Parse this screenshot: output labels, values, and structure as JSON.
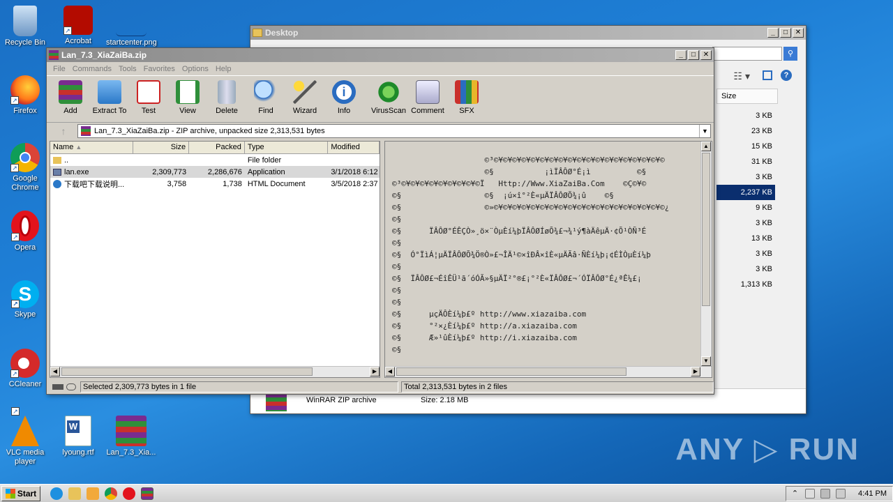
{
  "desktop": {
    "icons": [
      {
        "label": "Recycle Bin"
      },
      {
        "label": "Acrobat"
      },
      {
        "label": "startcenter.png"
      },
      {
        "label": "Firefox"
      },
      {
        "label": "Google Chrome"
      },
      {
        "label": "Opera"
      },
      {
        "label": "Skype"
      },
      {
        "label": "CCleaner"
      },
      {
        "label": "VLC media player"
      },
      {
        "label": "lyoung.rtf"
      },
      {
        "label": "Lan_7.3_Xia..."
      }
    ]
  },
  "explorer": {
    "title": "Desktop",
    "column_size": "Size",
    "sizes": [
      "3 KB",
      "23 KB",
      "15 KB",
      "31 KB",
      "3 KB",
      "2,237 KB",
      "9 KB",
      "3 KB",
      "13 KB",
      "3 KB",
      "3 KB",
      "1,313 KB"
    ],
    "details_type": "WinRAR ZIP archive",
    "details_size": "Size: 2.18 MB"
  },
  "winrar": {
    "title": "Lan_7.3_XiaZaiBa.zip",
    "menu": [
      "File",
      "Commands",
      "Tools",
      "Favorites",
      "Options",
      "Help"
    ],
    "toolbar": [
      "Add",
      "Extract To",
      "Test",
      "View",
      "Delete",
      "Find",
      "Wizard",
      "Info",
      "VirusScan",
      "Comment",
      "SFX"
    ],
    "address": "Lan_7.3_XiaZaiBa.zip - ZIP archive, unpacked size 2,313,531 bytes",
    "columns": [
      "Name",
      "Size",
      "Packed",
      "Type",
      "Modified"
    ],
    "files": [
      {
        "name": "..",
        "size": "",
        "packed": "",
        "type": "File folder",
        "modified": ""
      },
      {
        "name": "lan.exe",
        "size": "2,309,773",
        "packed": "2,286,676",
        "type": "Application",
        "modified": "3/1/2018 6:12"
      },
      {
        "name": "下载吧下载说明...",
        "size": "3,758",
        "packed": "1,738",
        "type": "HTML Document",
        "modified": "3/5/2018 2:37"
      }
    ],
    "preview_lines": [
      "                    ©³©¥©¥©¥©¥©¥©¥©¥©¥©¥©¥©¥©¥©¥©¥©¥©¥©¥©¥©",
      "                    ©§           ¡ìÏÂÔØ°É¡ì          ©§",
      "©³©¥©¥©¥©¥©¥©¥©¥©¥©Ï   Http://Www.XiaZaiBa.Com    ©Ç©¥©",
      "©§                  ©§  ¡ú×î°²È«µÄÏÂÔØÕ¾¡û    ©§",
      "©§                  ©»©¥©¥©¥©¥©¥©¥©¥©¥©¥©¥©¥©¥©¥©¥©¥©¥©¥©¥©¿",
      "©§",
      "©§      ÏÂÔØ°ÉÊÇÒ»¸ö×¨ÒµÈí¼þÏÂÔØÍøÕ¾£¬¾­¹ý¶àÄêµÄ·¢Õ¹ÒÑ³É",
      "©§",
      "©§  Ó°ÏìÁ¦µÄÏÂÔØÕ¾Ö®Ò»£¬ÎÄ¹©×îÐÂ×îÈ«µÄÃâ·ÑÈí¼þ¡¢ÉÌÒµÈí¼þ",
      "©§",
      "©§  ÏÂÔØ£¬ÉîÊÜ¹ã´óÓÃ»§µÄÏ²°®£¡°²È«ÏÂÔØ£¬´ÓÏÂÔØ°É¿ªÊ¼£¡",
      "©§",
      "©§",
      "©§      µçÄÔÈí¼þ£º http://www.xiazaiba.com",
      "©§      °²×¿Èí¼þ£º http://a.xiazaiba.com",
      "©§      Æ»¹ûÈí¼þ£º http://i.xiazaiba.com",
      "©§"
    ],
    "status_left": "Selected 2,309,773 bytes in 1 file",
    "status_right": "Total 2,313,531 bytes in 2 files"
  },
  "taskbar": {
    "start": "Start",
    "clock": "4:41 PM"
  },
  "watermark": "ANY ▷ RUN"
}
